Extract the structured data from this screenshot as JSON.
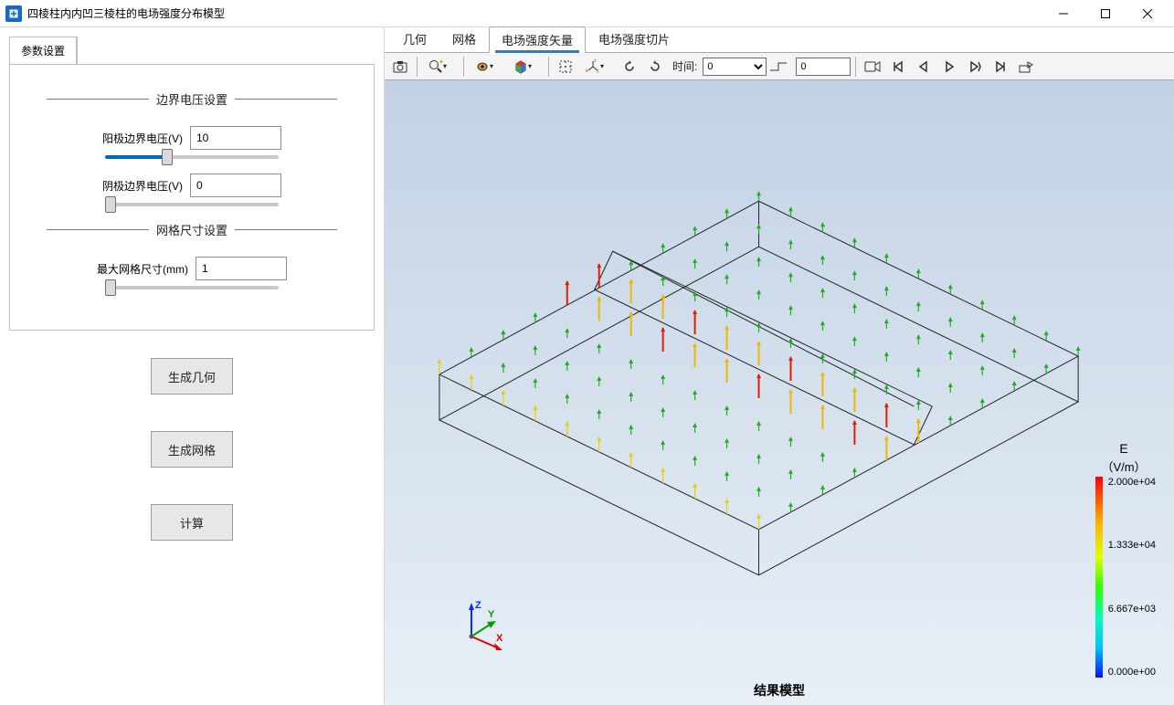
{
  "window": {
    "title": "四棱柱内内凹三棱柱的电场强度分布模型"
  },
  "leftTabs": {
    "t0": "参数设置"
  },
  "groups": {
    "voltage": {
      "title": "边界电压设置",
      "anode": {
        "label": "阳极边界电压(V)",
        "value": "10"
      },
      "cathode": {
        "label": "阴极边界电压(V)",
        "value": "0"
      }
    },
    "mesh": {
      "title": "网格尺寸设置",
      "max": {
        "label": "最大网格尺寸(mm)",
        "value": "1"
      }
    }
  },
  "buttons": {
    "geom": "生成几何",
    "mesh": "生成网格",
    "calc": "计算"
  },
  "rightTabs": {
    "t0": "几何",
    "t1": "网格",
    "t2": "电场强度矢量",
    "t3": "电场强度切片"
  },
  "toolbar": {
    "timeLabel": "时间:",
    "timeSelect": "0",
    "timeInput": "0"
  },
  "viewer": {
    "resultTitle": "结果模型",
    "colorbar": {
      "label": "E",
      "unit": "（V/m）",
      "t0": "2.000e+04",
      "t1": "1.333e+04",
      "t2": "6.667e+03",
      "t3": "0.000e+00"
    },
    "axes": {
      "x": "X",
      "y": "Y",
      "z": "Z"
    }
  }
}
